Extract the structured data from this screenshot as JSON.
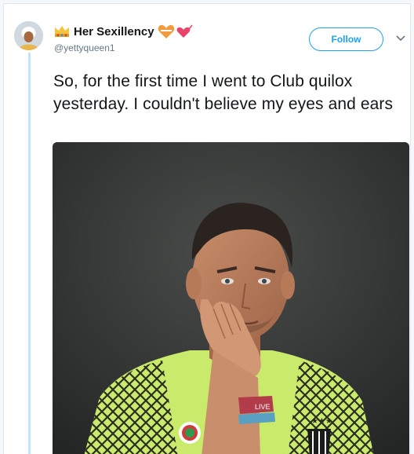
{
  "tweet": {
    "display_name": "Her Sexillency",
    "handle": "@yettyqueen1",
    "follow_label": "Follow",
    "text": "So, for the first time I went to Club quilox yesterday. I couldn't believe my eyes and ears"
  },
  "photo": {
    "jersey_text": "LIVE"
  },
  "icons": {
    "crown": "crown-emoji-icon",
    "hearts": "hearts-emoji-icon",
    "caret": "chevron-down-icon"
  },
  "colors": {
    "accent": "#1da1f2",
    "thread": "#c4e3f7",
    "jersey": "#c9ea6a"
  }
}
